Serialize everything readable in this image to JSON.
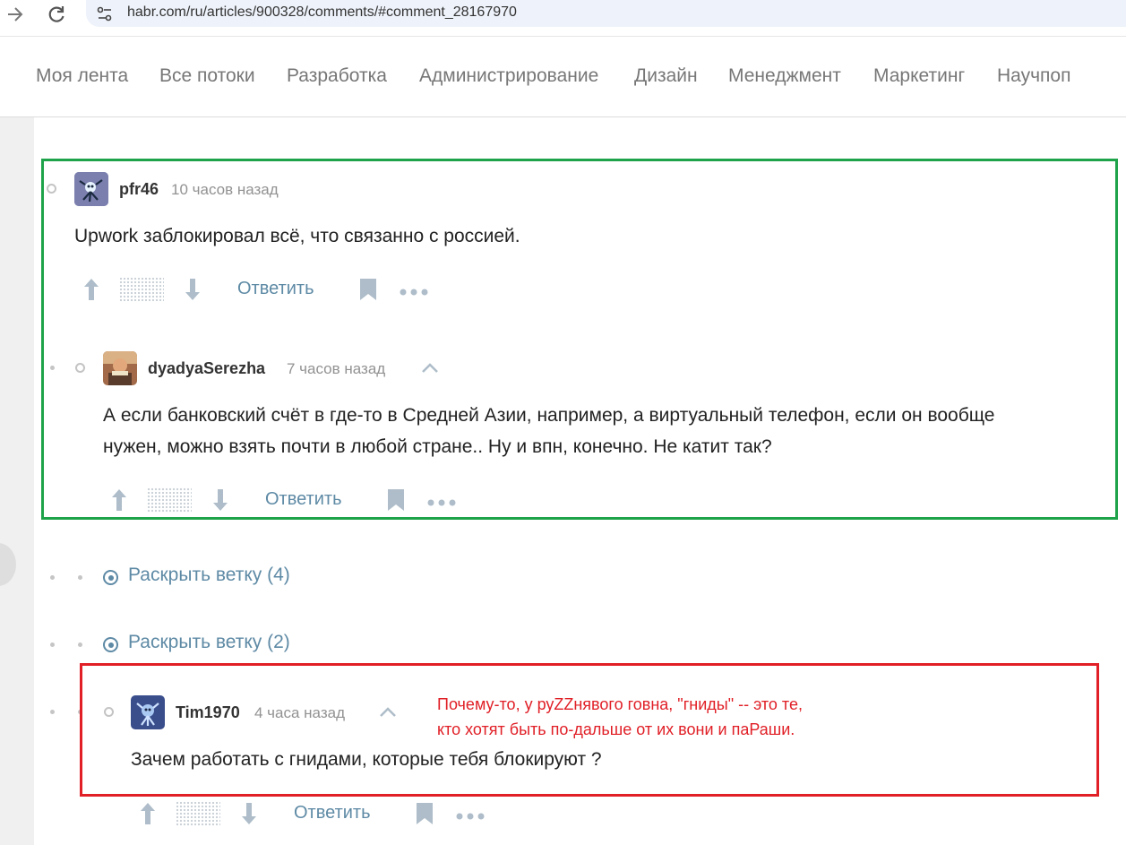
{
  "browser": {
    "back_icon": "arrow-right-icon",
    "reload_icon": "reload-icon",
    "site_info_icon": "tune-icon",
    "url": "habr.com/ru/articles/900328/comments/#comment_28167970"
  },
  "top_nav": {
    "items": [
      {
        "label": "Моя лента"
      },
      {
        "label": "Все потоки"
      },
      {
        "label": "Разработка"
      },
      {
        "label": "Администрирование"
      },
      {
        "label": "Дизайн"
      },
      {
        "label": "Менеджмент"
      },
      {
        "label": "Маркетинг"
      },
      {
        "label": "Научпоп"
      }
    ]
  },
  "comments": [
    {
      "username": "pfr46",
      "time": "10 часов назад",
      "text": "Upwork заблокировал всё, что связанно с россией.",
      "reply_label": "Ответить"
    },
    {
      "username": "dyadyaSerezha",
      "time": "7 часов назад",
      "text_line1": "А если банковский счёт в где-то в Средней Азии, например, а виртуальный телефон, если он вообще",
      "text_line2": "нужен, можно взять почти в любой стране.. Ну и впн, конечно. Не катит так?",
      "reply_label": "Ответить"
    },
    {
      "username": "Tim1970",
      "time": "4 часа назад",
      "text": "Зачем работать с гнидами, которые тебя блокируют ?",
      "reply_label": "Ответить"
    }
  ],
  "expand_threads": [
    {
      "label": "Раскрыть ветку (4)"
    },
    {
      "label": "Раскрыть ветку (2)"
    }
  ],
  "annotation": {
    "line1": "Почему-то, у руZZнявого говна, \"гниды\" -- это те,",
    "line2": "кто хотят быть по-дальше от их вони и паРаши.",
    "green_color": "#1fa34a",
    "red_color": "#e01f26"
  },
  "colors": {
    "link": "#5e8aa5",
    "muted": "#929292",
    "nav": "#777777"
  }
}
